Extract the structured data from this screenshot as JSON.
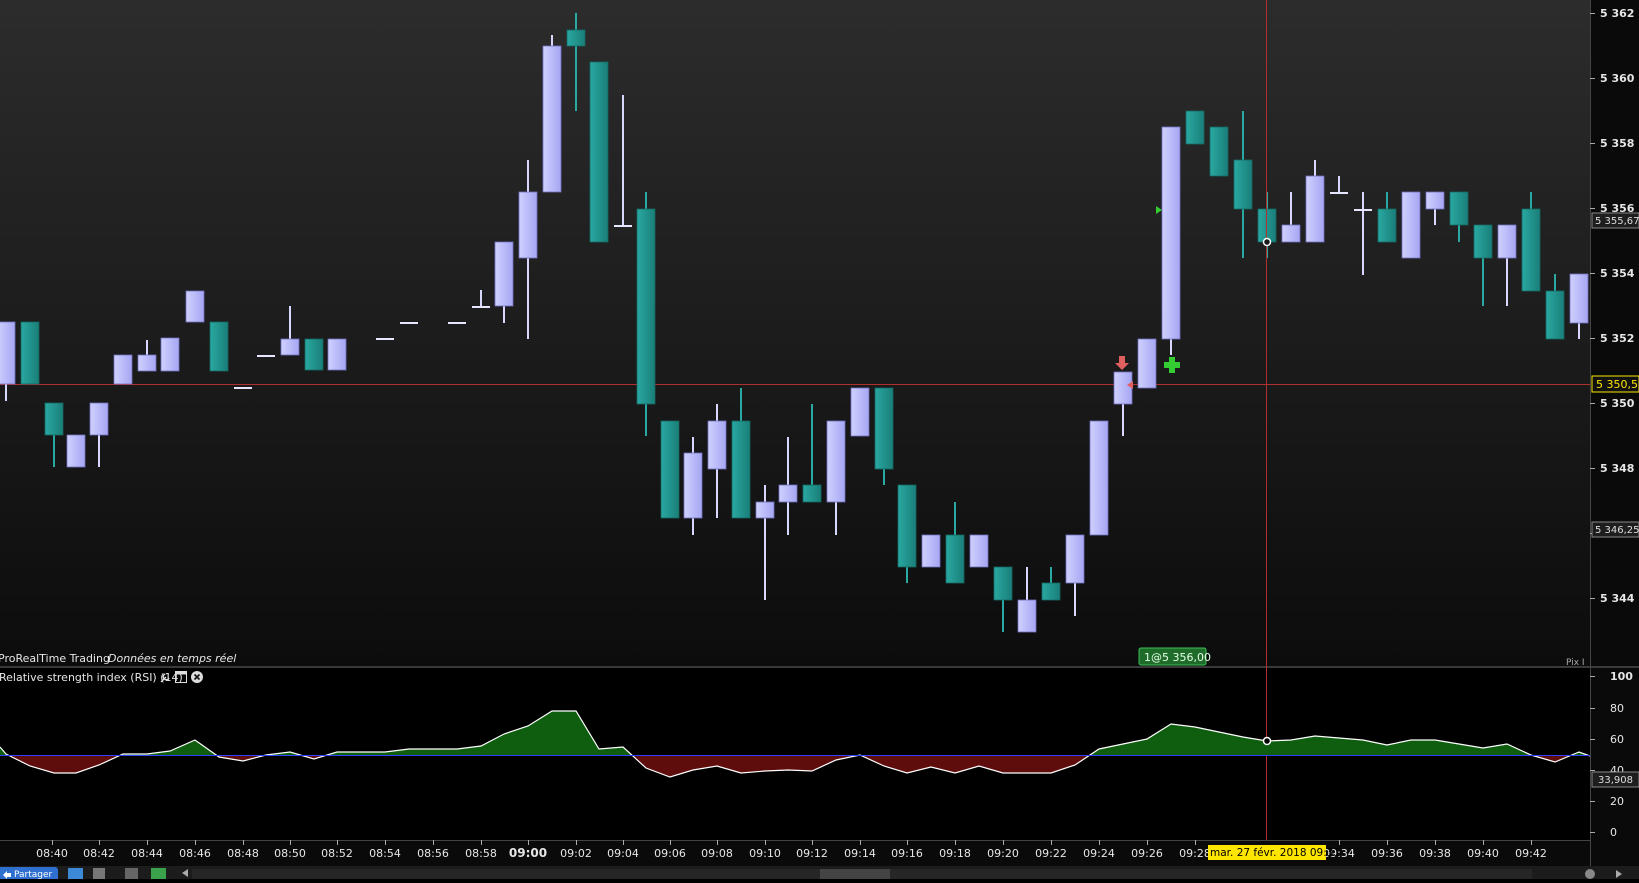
{
  "price_panel": {
    "provider": "ProRealTime Trading",
    "feed_status": "Données en temps réel",
    "y_ticks": [
      "5 362",
      "5 360",
      "5 358",
      "5 356",
      "5 354",
      "5 352",
      "5 350",
      "5 348",
      "5 346",
      "5 344"
    ],
    "current_price_label": "5 350,5",
    "level_label_1": "5 355,67",
    "level_label_2": "5 346,25",
    "position_tag": "1@5 356,00",
    "corner_text": "Pix I"
  },
  "indicator_panel": {
    "title": "Relative strength index (RSI) (14)",
    "y_ticks": [
      "100",
      "80",
      "60",
      "40",
      "20",
      "0"
    ],
    "current_value_label": "33,908"
  },
  "time_axis": {
    "labels": [
      "08:40",
      "08:42",
      "08:44",
      "08:46",
      "08:48",
      "08:50",
      "08:52",
      "08:54",
      "08:56",
      "08:58",
      "09:00",
      "09:02",
      "09:04",
      "09:06",
      "09:08",
      "09:10",
      "09:12",
      "09:14",
      "09:16",
      "09:18",
      "09:20",
      "09:22",
      "09:24",
      "09:26",
      "09:28",
      "09:34",
      "09:36",
      "09:38",
      "09:40",
      "09:42"
    ],
    "bold_label": "09:00",
    "crosshair_label": "mar. 27 févr. 2018 09:31"
  },
  "toolbar": {
    "share_label": "Partager"
  },
  "colors": {
    "bull": "#b8b8f8",
    "bear": "#239a94",
    "bg_top": "#2a2a2a",
    "bg_bottom": "#0b0b0b",
    "crosshair": "#b03030",
    "rsi_mid": "#3040ff",
    "rsi_above": "#126a12",
    "rsi_below": "#6a1010",
    "highlight": "#ffe600"
  },
  "icons": {
    "share": "share-icon",
    "settings": "wrench-icon",
    "window": "window-icon",
    "close": "close-icon",
    "sell_signal": "down-arrow-icon",
    "cross_signal": "cross-marker-icon"
  }
}
